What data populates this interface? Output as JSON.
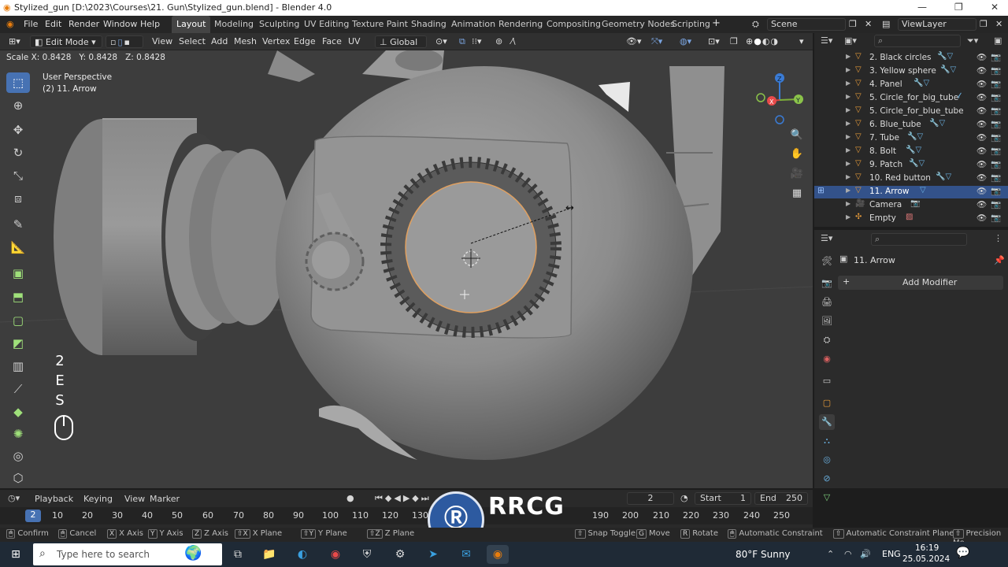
{
  "window": {
    "title": "Stylized_gun [D:\\2023\\Courses\\21. Gun\\Stylized_gun.blend] - Blender 4.0"
  },
  "menu": [
    "File",
    "Edit",
    "Render",
    "Window",
    "Help"
  ],
  "workspaces": [
    "Layout",
    "Modeling",
    "Sculpting",
    "UV Editing",
    "Texture Paint",
    "Shading",
    "Animation",
    "Rendering",
    "Compositing",
    "Geometry Nodes",
    "Scripting"
  ],
  "scene": "Scene",
  "viewlayer": "ViewLayer",
  "header3d": {
    "mode": "Edit Mode",
    "menus": [
      "View",
      "Select",
      "Add",
      "Mesh",
      "Vertex",
      "Edge",
      "Face",
      "UV"
    ],
    "orientation": "Global"
  },
  "scale_readout": {
    "x": "Scale X: 0.8428",
    "y": "Y: 0.8428",
    "z": "Z: 0.8428"
  },
  "viewport": {
    "perspective": "User Perspective",
    "object": "(2) 11. Arrow",
    "keys": [
      "2",
      "E",
      "S"
    ]
  },
  "outliner": {
    "items": [
      {
        "name": "2. Black circles",
        "selected": false
      },
      {
        "name": "3. Yellow sphere",
        "selected": false
      },
      {
        "name": "4. Panel",
        "selected": false
      },
      {
        "name": "5. Circle_for_big_tube",
        "selected": false
      },
      {
        "name": "5. Circle_for_blue_tube",
        "selected": false
      },
      {
        "name": "6. Blue_tube",
        "selected": false
      },
      {
        "name": "7. Tube",
        "selected": false
      },
      {
        "name": "8. Bolt",
        "selected": false
      },
      {
        "name": "9. Patch",
        "selected": false
      },
      {
        "name": "10. Red button",
        "selected": false
      },
      {
        "name": "11. Arrow",
        "selected": true
      },
      {
        "name": "Camera",
        "selected": false
      },
      {
        "name": "Empty",
        "selected": false
      }
    ]
  },
  "properties": {
    "object": "11. Arrow",
    "add_modifier": "Add Modifier"
  },
  "timeline": {
    "menus": [
      "Playback",
      "Keying",
      "View",
      "Marker"
    ],
    "current_frame": "2",
    "start_label": "Start",
    "start": "1",
    "end_label": "End",
    "end": "250",
    "ticks": [
      "2",
      "10",
      "20",
      "30",
      "40",
      "50",
      "60",
      "70",
      "80",
      "90",
      "100",
      "110",
      "120",
      "130",
      "190",
      "200",
      "210",
      "220",
      "230",
      "240",
      "250"
    ]
  },
  "statusbar": {
    "items": [
      {
        "key": "",
        "label": "Confirm"
      },
      {
        "key": "",
        "label": "Cancel"
      },
      {
        "key": "X",
        "label": "X Axis"
      },
      {
        "key": "Y",
        "label": "Y Axis"
      },
      {
        "key": "Z",
        "label": "Z Axis"
      },
      {
        "key": "⇧X",
        "label": "X Plane"
      },
      {
        "key": "⇧Y",
        "label": "Y Plane"
      },
      {
        "key": "⇧Z",
        "label": "Z Plane"
      },
      {
        "key": "",
        "label": "Snap Toggle"
      },
      {
        "key": "G",
        "label": "Move"
      },
      {
        "key": "R",
        "label": "Rotate"
      },
      {
        "key": "",
        "label": "Automatic Constraint"
      },
      {
        "key": "",
        "label": "Automatic Constraint Plane"
      },
      {
        "key": "",
        "label": "Precision Mo"
      }
    ]
  },
  "taskbar": {
    "search_placeholder": "Type here to search",
    "weather": "80°F  Sunny",
    "lang": "ENG",
    "time": "16:19",
    "date": "25.05.2024"
  },
  "watermark": {
    "text": "RRCG",
    "subtext": "人人素材"
  }
}
